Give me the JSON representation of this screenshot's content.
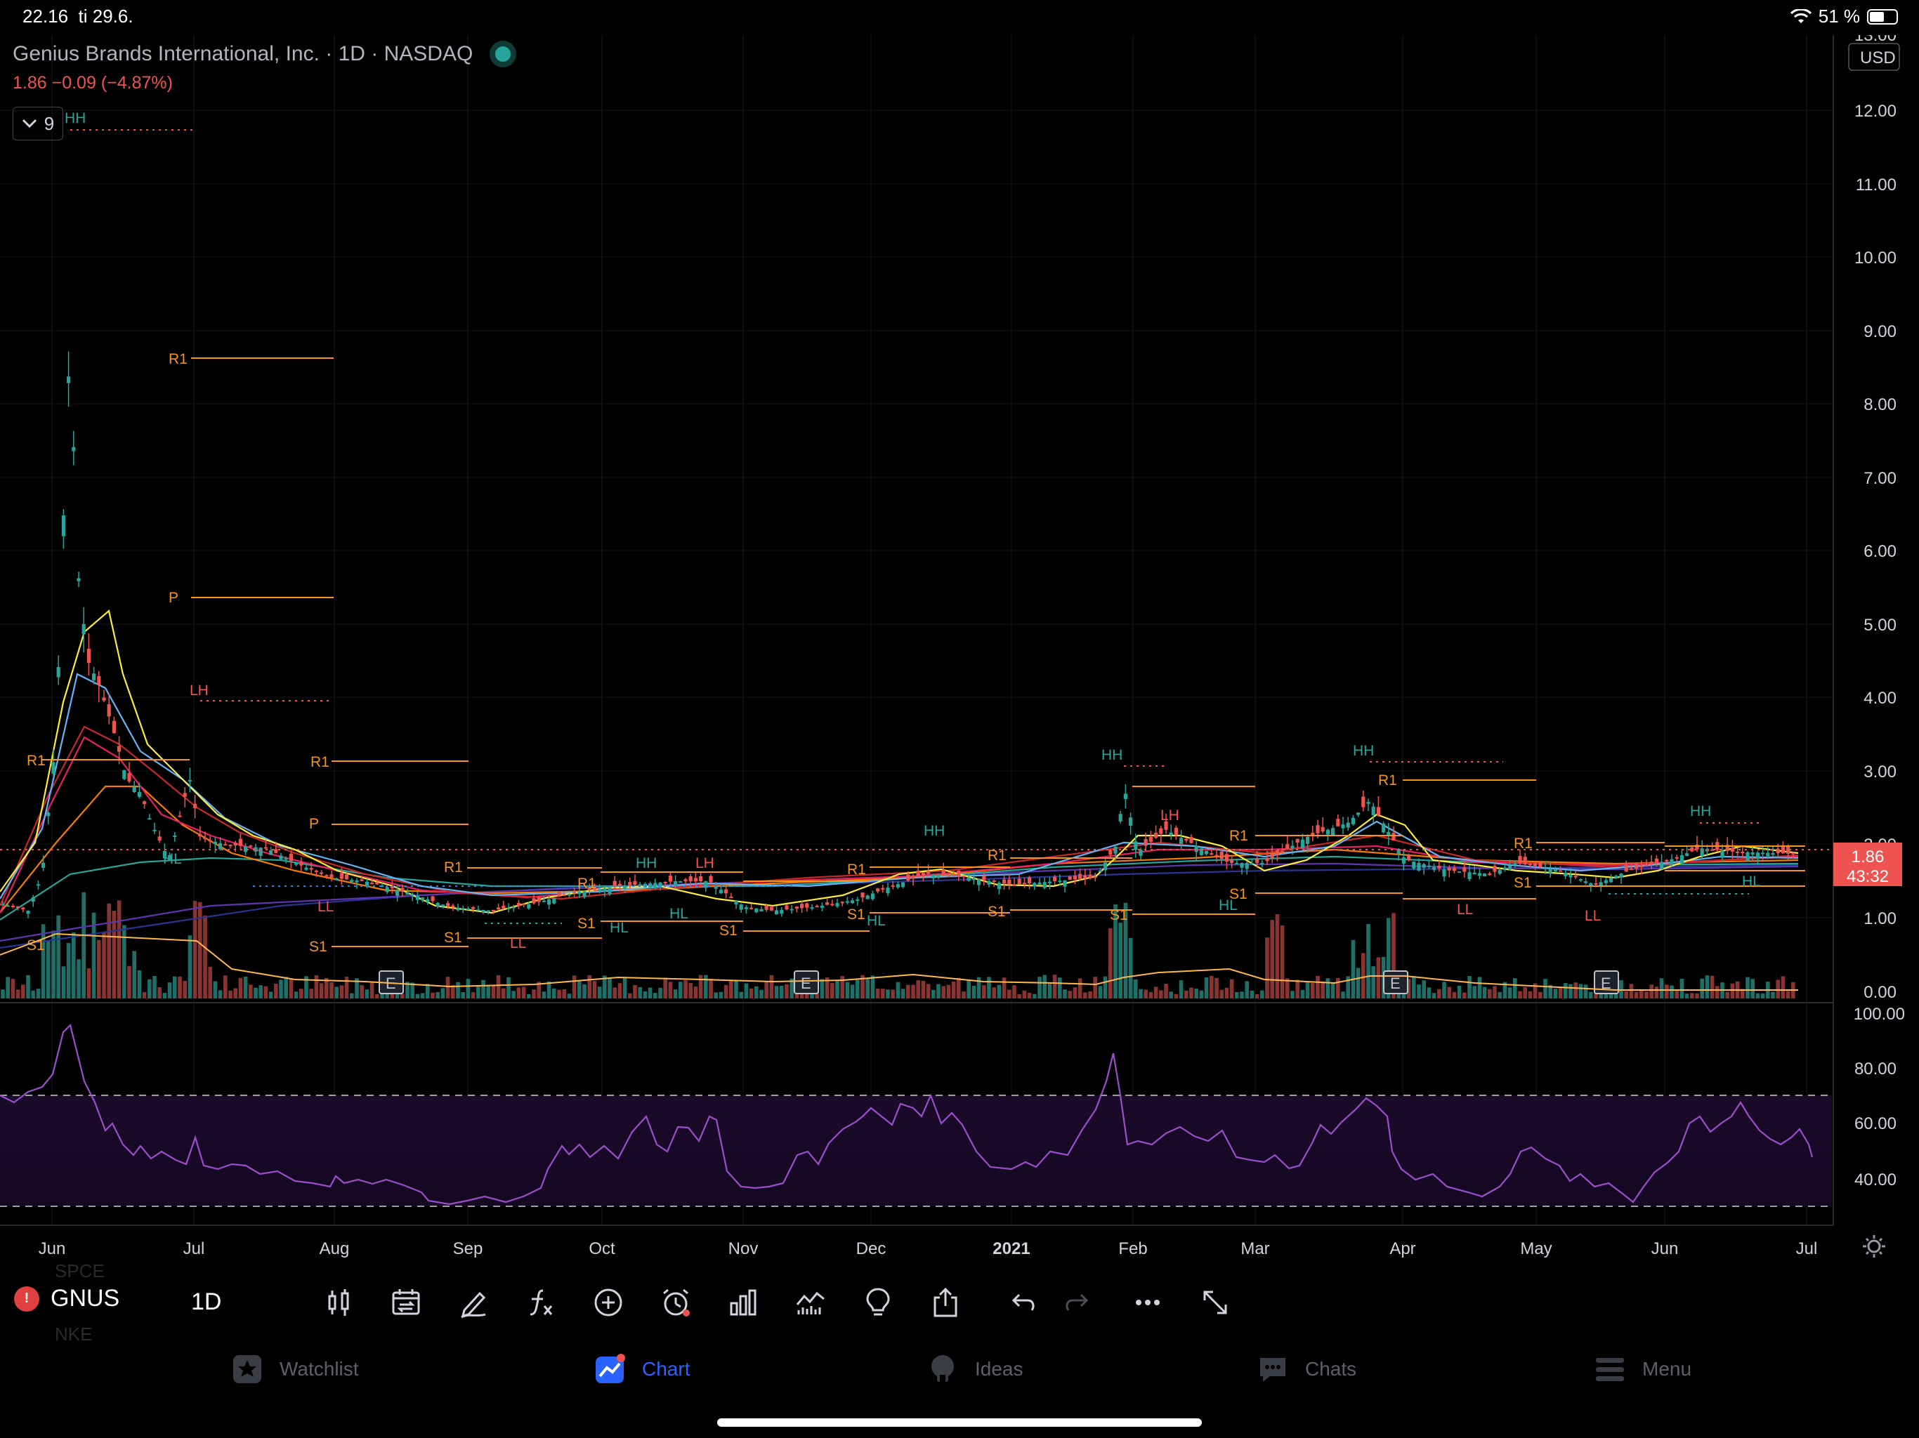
{
  "status": {
    "time": "22.16",
    "date": "ti 29.6.",
    "battery": "51 %"
  },
  "header": {
    "title": "Genius Brands International, Inc. · 1D · NASDAQ",
    "price_line": "1.86 −0.09 (−4.87%)",
    "indicator_count": "9"
  },
  "price_axis": {
    "labels": [
      "13.00",
      "12.00",
      "11.00",
      "10.00",
      "9.00",
      "8.00",
      "7.00",
      "6.00",
      "5.00",
      "4.00",
      "3.00",
      "2.00",
      "1.00",
      "0.00"
    ],
    "currency": "USD",
    "last_price": "1.86",
    "countdown": "43:32"
  },
  "rsi_axis": {
    "labels": [
      "100.00",
      "80.00",
      "60.00",
      "40.00"
    ]
  },
  "time_axis": {
    "labels": [
      "Jun",
      "Jul",
      "Aug",
      "Sep",
      "Oct",
      "Nov",
      "Dec",
      "2021",
      "Feb",
      "Mar",
      "Apr",
      "May",
      "Jun",
      "Jul"
    ]
  },
  "chart_labels": {
    "pivots": [
      "R1",
      "P",
      "R1",
      "R1",
      "P",
      "S1",
      "S1",
      "S1",
      "S1",
      "S1",
      "S1",
      "S1",
      "S1",
      "S1",
      "R1",
      "R1",
      "R1",
      "R1",
      "R1",
      "R1",
      "R1",
      "S1"
    ],
    "swings": [
      "HH",
      "LH",
      "HL",
      "LL",
      "LL",
      "HH",
      "LH",
      "HL",
      "HL",
      "HH",
      "HL",
      "HH",
      "LH",
      "HH",
      "HL",
      "LL",
      "LL",
      "HH",
      "HL"
    ],
    "earnings": [
      "E",
      "E",
      "E",
      "E"
    ]
  },
  "toolbar": {
    "symbol": "GNUS",
    "interval": "1D",
    "ghost_above": "SPCE",
    "ghost_below": "NKE"
  },
  "tabs": [
    {
      "label": "Watchlist",
      "icon": "star-icon"
    },
    {
      "label": "Chart",
      "icon": "chart-icon"
    },
    {
      "label": "Ideas",
      "icon": "lightbulb-icon"
    },
    {
      "label": "Chats",
      "icon": "chat-bubble-icon"
    },
    {
      "label": "Menu",
      "icon": "hamburger-icon"
    }
  ],
  "colors": {
    "up": "#26a69a",
    "down": "#ef5350",
    "pivot": "#f7931a",
    "rsi": "#9c4dcc",
    "accent": "#2962ff",
    "ma_yellow": "#ffeb3b"
  }
}
